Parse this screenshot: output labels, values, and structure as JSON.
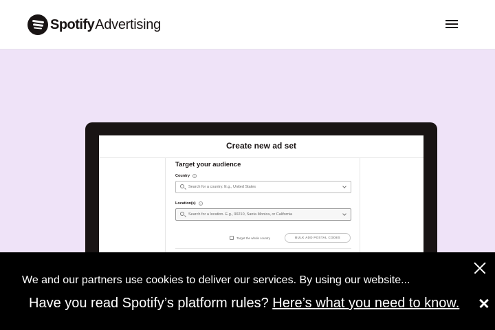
{
  "header": {
    "logo_brand": "Spotify",
    "logo_product": "Advertising",
    "logo_icon": "spotify-logo-icon",
    "menu_icon": "hamburger-menu-icon"
  },
  "hero": {
    "background_color": "#efe3f8",
    "screen": {
      "title": "Create new ad set",
      "section_title": "Target your audience",
      "country_label": "Country",
      "country_placeholder": "Search for a country. E.g., United States",
      "location_label": "Location(s)",
      "location_placeholder": "Search for a location. E.g., 90210, Santa Monica, or California",
      "checkbox_label": "Target the whole country",
      "bulk_button": "BULK ADD POSTAL CODES"
    }
  },
  "cookie_banner": {
    "text": "We and our partners use cookies to deliver our services. By using our website...",
    "close_icon": "close-icon"
  },
  "notice": {
    "text": "Have you read Spotify’s platform rules?",
    "link": "Here’s what you need to know.",
    "close_icon": "close-icon"
  }
}
